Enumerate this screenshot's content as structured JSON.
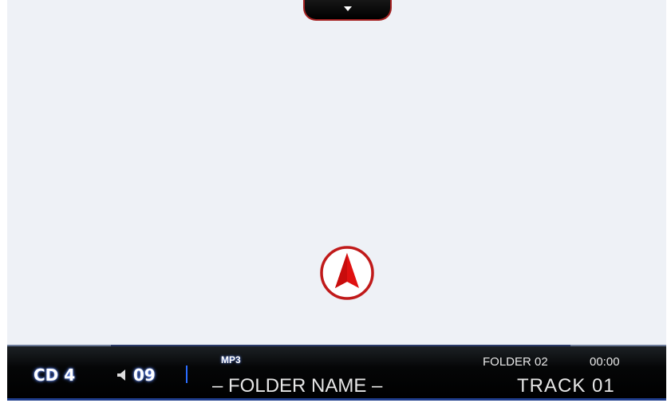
{
  "pulldown": {
    "icon": "chevron-down-icon"
  },
  "map": {
    "marker_icon": "vehicle-position-arrow-icon",
    "marker_color": "#e01010",
    "ring_color": "#c01a1a"
  },
  "status_bar": {
    "source": "CD 4",
    "volume_icon": "speaker-icon",
    "volume": "09",
    "format": "MP3",
    "folder_name": "– FOLDER NAME –",
    "folder": "FOLDER 02",
    "time": "00:00",
    "track": "TRACK 01",
    "accent_color": "#2a6cff"
  }
}
